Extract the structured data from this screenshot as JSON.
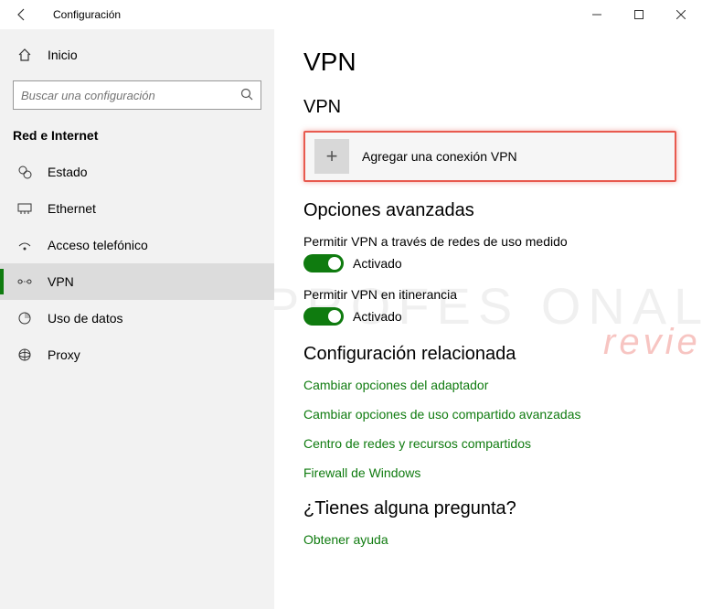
{
  "window": {
    "title": "Configuración"
  },
  "sidebar": {
    "home": "Inicio",
    "search_placeholder": "Buscar una configuración",
    "section": "Red e Internet",
    "items": [
      {
        "label": "Estado"
      },
      {
        "label": "Ethernet"
      },
      {
        "label": "Acceso telefónico"
      },
      {
        "label": "VPN"
      },
      {
        "label": "Uso de datos"
      },
      {
        "label": "Proxy"
      }
    ]
  },
  "main": {
    "title": "VPN",
    "section_vpn": "VPN",
    "add_vpn": "Agregar una conexión VPN",
    "section_advanced": "Opciones avanzadas",
    "setting1": {
      "label": "Permitir VPN a través de redes de uso medido",
      "state": "Activado"
    },
    "setting2": {
      "label": "Permitir VPN en itinerancia",
      "state": "Activado"
    },
    "section_related": "Configuración relacionada",
    "links": [
      "Cambiar opciones del adaptador",
      "Cambiar opciones de uso compartido avanzadas",
      "Centro de redes y recursos compartidos",
      "Firewall de Windows"
    ],
    "section_help": "¿Tienes alguna pregunta?",
    "help_link": "Obtener ayuda"
  },
  "watermark": {
    "line1": "PROFES  ONAL",
    "line2": "review"
  }
}
